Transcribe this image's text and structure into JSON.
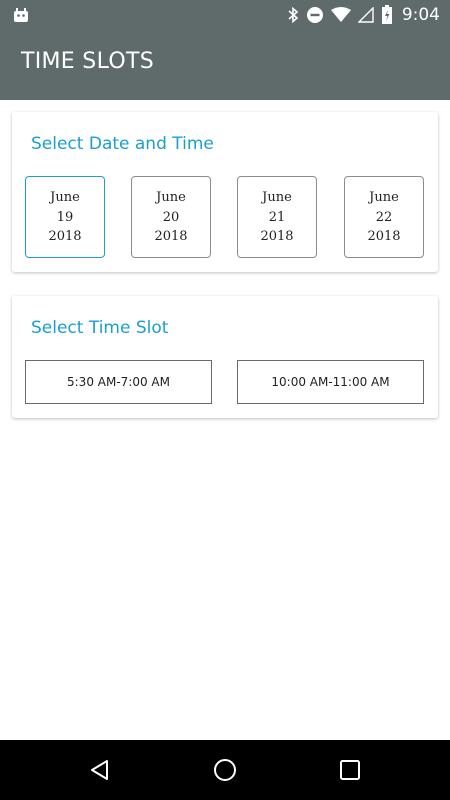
{
  "status_bar": {
    "time": "9:04",
    "icons": [
      "android-icon",
      "bluetooth-icon",
      "do-not-disturb-icon",
      "wifi-icon",
      "signal-icon",
      "battery-icon"
    ]
  },
  "app_bar": {
    "title": "TIME SLOTS"
  },
  "date_section": {
    "title": "Select Date and Time",
    "dates": [
      {
        "month": "June",
        "day": "19",
        "year": "2018",
        "selected": true
      },
      {
        "month": "June",
        "day": "20",
        "year": "2018",
        "selected": false
      },
      {
        "month": "June",
        "day": "21",
        "year": "2018",
        "selected": false
      },
      {
        "month": "June",
        "day": "22",
        "year": "2018",
        "selected": false
      }
    ]
  },
  "slot_section": {
    "title": "Select Time Slot",
    "slots": [
      "5:30 AM-7:00 AM",
      "10:00 AM-11:00 AM"
    ]
  },
  "nav_bar": {
    "buttons": [
      "back-icon",
      "home-icon",
      "recents-icon"
    ]
  },
  "colors": {
    "app_bar": "#5f6b6b",
    "accent": "#1a9fd0",
    "nav_bar": "#000000"
  }
}
